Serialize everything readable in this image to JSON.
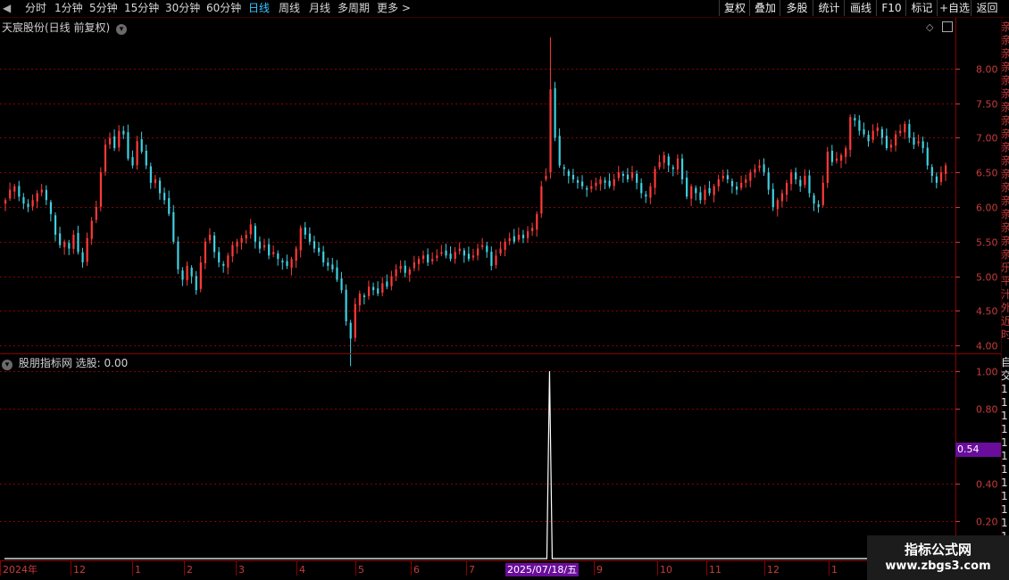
{
  "toolbar": {
    "back_label": "◀",
    "periods": [
      "分时",
      "1分钟",
      "5分钟",
      "15分钟",
      "30分钟",
      "60分钟",
      "日线",
      "周线",
      "月线",
      "多周期",
      "更多 >"
    ],
    "active_period": "日线",
    "right_buttons": [
      "复权",
      "叠加",
      "多股",
      "统计",
      "画线",
      "F10",
      "标记",
      "+自选",
      "返回"
    ]
  },
  "main_panel": {
    "title": "天宸股份(日线 前复权)",
    "y_ticks": [
      "8.00",
      "7.50",
      "7.00",
      "6.50",
      "6.00",
      "5.50",
      "5.00",
      "4.50",
      "4.00"
    ]
  },
  "indicator_panel": {
    "title": "股朋指标网 选股: 0.00",
    "y_ticks": [
      "1.00",
      "0.80",
      "0.40",
      "0.20"
    ],
    "current_label": "0.54"
  },
  "x_axis": {
    "labels": [
      "2024年",
      "12",
      "1",
      "2",
      "3",
      "4",
      "5",
      "6",
      "7",
      "9",
      "10",
      "11",
      "12",
      "1"
    ],
    "cursor_label": "2025/07/18/五"
  },
  "right_column": {
    "top_chars": [
      "亲",
      "亲",
      "亲",
      "亲",
      "亲",
      "亲",
      "亲",
      "亲",
      "亲",
      "亲",
      "亲",
      "亲",
      "亲",
      "亲",
      "亲",
      "亲",
      "亲",
      "亲",
      "乐",
      "平",
      "汁",
      "外",
      "近",
      "时"
    ],
    "bottom_chars": [
      "自",
      "交",
      "1",
      "1",
      "1",
      "1",
      "1",
      "1",
      "1",
      "1",
      "1",
      "1",
      "1",
      "1",
      "1",
      "1"
    ]
  },
  "watermark": {
    "line1": "指标公式网",
    "line2": "www.zbgs3.com"
  },
  "colors": {
    "up": "#ff3a3a",
    "down": "#3fd0e0",
    "grid": "#8b0000",
    "axis_text": "#c83c3c",
    "active_tab": "#39c6ff",
    "current_label_bg": "#6a0d9c",
    "signal_line": "#ffffff"
  },
  "chart_data": {
    "type": "candlestick",
    "title": "天宸股份(日线 前复权)",
    "ylim": [
      3.9,
      8.5
    ],
    "series": [
      {
        "name": "price",
        "values": [
          6.1,
          6.25,
          6.3,
          6.15,
          6.05,
          6.0,
          6.1,
          6.2,
          6.25,
          6.1,
          5.9,
          5.6,
          5.45,
          5.5,
          5.4,
          5.6,
          5.35,
          5.2,
          5.55,
          5.8,
          6.0,
          6.5,
          6.9,
          7.0,
          6.85,
          7.1,
          7.05,
          6.7,
          6.6,
          6.95,
          6.8,
          6.6,
          6.35,
          6.4,
          6.2,
          6.1,
          5.9,
          5.5,
          5.1,
          4.95,
          5.15,
          5.0,
          4.8,
          5.2,
          5.5,
          5.6,
          5.35,
          5.2,
          5.15,
          5.3,
          5.45,
          5.5,
          5.55,
          5.6,
          5.75,
          5.5,
          5.4,
          5.45,
          5.3,
          5.35,
          5.25,
          5.2,
          5.15,
          5.25,
          5.4,
          5.7,
          5.6,
          5.5,
          5.4,
          5.35,
          5.2,
          5.15,
          5.1,
          4.95,
          4.8,
          4.35,
          4.1,
          4.6,
          4.75,
          4.7,
          4.85,
          4.8,
          4.75,
          4.9,
          4.85,
          5.0,
          5.1,
          5.15,
          5.05,
          5.1,
          5.2,
          5.25,
          5.3,
          5.2,
          5.25,
          5.3,
          5.35,
          5.3,
          5.25,
          5.35,
          5.4,
          5.3,
          5.25,
          5.3,
          5.4,
          5.45,
          5.35,
          5.15,
          5.3,
          5.4,
          5.5,
          5.55,
          5.5,
          5.6,
          5.55,
          5.65,
          5.7,
          5.9,
          6.3,
          6.45,
          7.7,
          7.0,
          6.6,
          6.55,
          6.45,
          6.4,
          6.35,
          6.3,
          6.25,
          6.3,
          6.35,
          6.4,
          6.35,
          6.3,
          6.4,
          6.5,
          6.45,
          6.4,
          6.5,
          6.35,
          6.2,
          6.15,
          6.3,
          6.55,
          6.65,
          6.75,
          6.6,
          6.55,
          6.7,
          6.4,
          6.15,
          6.3,
          6.2,
          6.1,
          6.25,
          6.2,
          6.3,
          6.4,
          6.45,
          6.4,
          6.3,
          6.25,
          6.35,
          6.4,
          6.5,
          6.55,
          6.6,
          6.5,
          6.25,
          6.0,
          6.1,
          6.2,
          6.35,
          6.5,
          6.4,
          6.3,
          6.45,
          6.2,
          6.05,
          6.0,
          6.35,
          6.8,
          6.65,
          6.7,
          6.75,
          6.85,
          7.3,
          7.25,
          7.1,
          7.05,
          6.95,
          7.1,
          7.15,
          7.0,
          6.85,
          6.9,
          7.05,
          7.1,
          7.2,
          7.0,
          6.9,
          6.95,
          6.85,
          6.6,
          6.45,
          6.35,
          6.5,
          6.6
        ]
      },
      {
        "name": "选股",
        "values": [
          0,
          1,
          0
        ]
      }
    ],
    "xlabel": "",
    "ylabel": ""
  }
}
